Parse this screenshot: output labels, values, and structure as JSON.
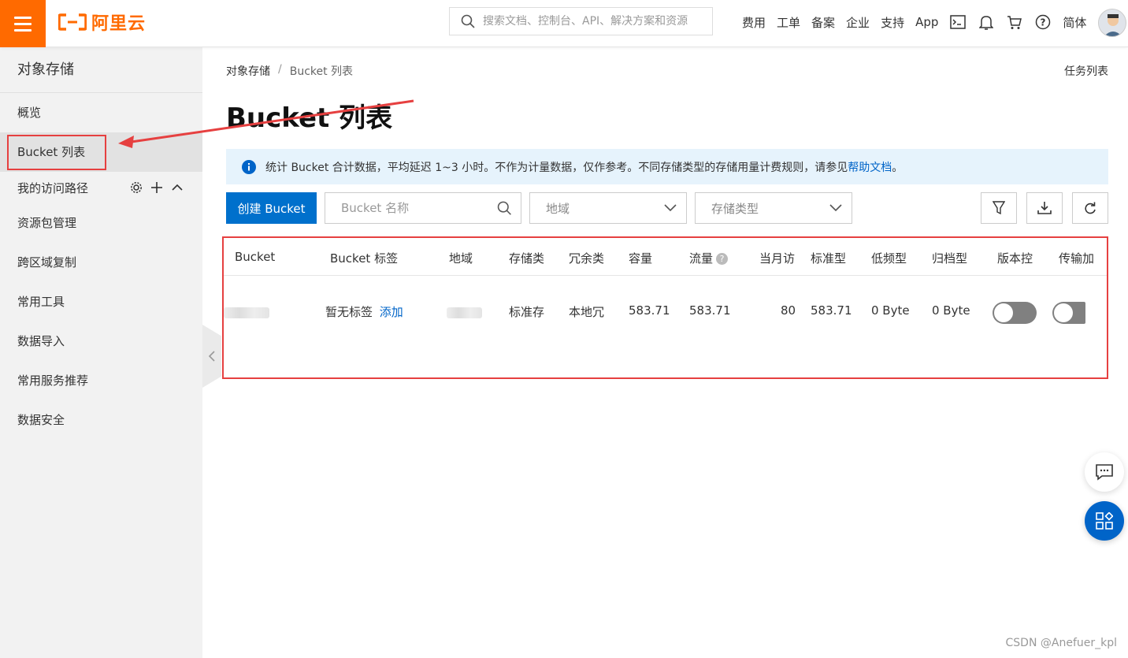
{
  "header": {
    "logo_text": "阿里云",
    "search_placeholder": "搜索文档、控制台、API、解决方案和资源",
    "nav_items": [
      "费用",
      "工单",
      "备案",
      "企业",
      "支持",
      "App"
    ],
    "lang": "简体",
    "accent_color": "#ff6a00"
  },
  "sidebar": {
    "title": "对象存储",
    "overview": "概览",
    "active_item": "Bucket 列表",
    "group_label": "我的访问路径",
    "items": [
      "资源包管理",
      "跨区域复制",
      "常用工具",
      "数据导入",
      "常用服务推荐",
      "数据安全"
    ]
  },
  "breadcrumb": {
    "root": "对象存储",
    "separator": "/",
    "current": "Bucket 列表"
  },
  "task_link": "任务列表",
  "page_title": "Bucket 列表",
  "notice": {
    "text": "统计 Bucket 合计数据，平均延迟 1~3 小时。不作为计量数据，仅作参考。不同存储类型的存储用量计费规则，请参见",
    "link": "帮助文档",
    "end": "。"
  },
  "toolbar": {
    "create_label": "创建 Bucket",
    "name_placeholder": "Bucket 名称",
    "region_placeholder": "地域",
    "storage_placeholder": "存储类型",
    "primary_color": "#0070cc"
  },
  "table": {
    "columns": [
      "Bucket",
      "Bucket 标签",
      "地域",
      "存储类",
      "冗余类",
      "容量",
      "流量",
      "当月访",
      "标准型",
      "低频型",
      "归档型",
      "版本控",
      "传输加"
    ],
    "row": {
      "tag": "暂无标签",
      "tag_action": "添加",
      "storage_class": "标准存",
      "redundancy": "本地冗",
      "capacity": "583.71",
      "traffic": "583.71",
      "monthly_visits": "80",
      "standard": "583.71",
      "infrequent": "0 Byte",
      "archive": "0 Byte"
    }
  },
  "watermark": "CSDN @Anefuer_kpl",
  "highlight_color": "#e64040"
}
